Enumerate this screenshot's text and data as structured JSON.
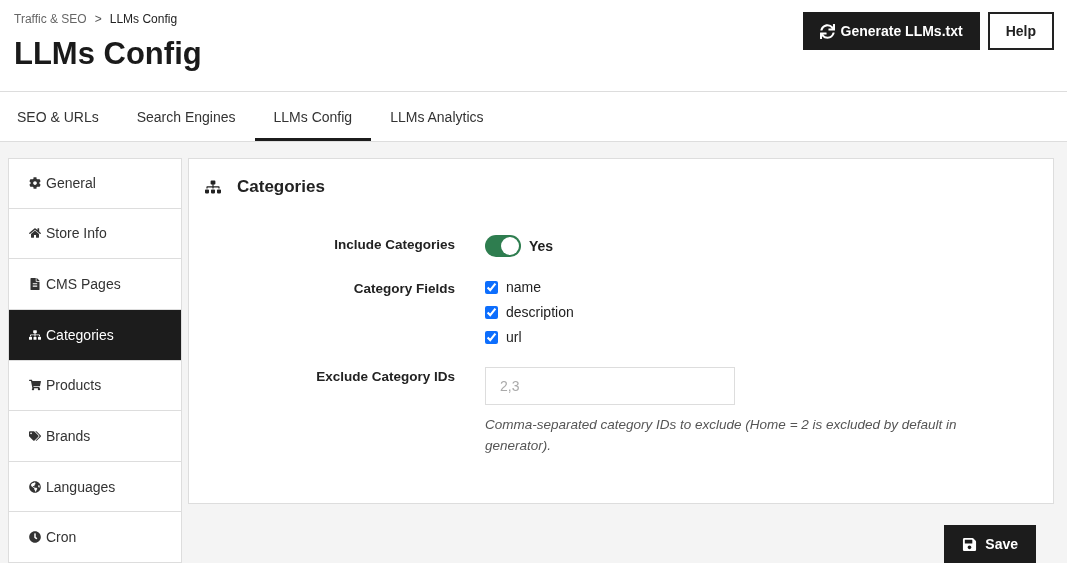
{
  "breadcrumb": [
    {
      "label": "Traffic & SEO",
      "current": false
    },
    {
      "label": "LLMs Config",
      "current": true
    }
  ],
  "breadcrumb_separator": ">",
  "title": "LLMs Config",
  "header_buttons": [
    {
      "label": "Generate LLMs.txt",
      "kind": "primary"
    },
    {
      "label": "Help",
      "kind": "outline"
    }
  ],
  "tabs": [
    {
      "label": "SEO & URLs",
      "selected": false
    },
    {
      "label": "Search Engines",
      "selected": false
    },
    {
      "label": "LLMs Config",
      "selected": true
    },
    {
      "label": "LLMs Analytics",
      "selected": false
    }
  ],
  "sidebar": {
    "items": [
      {
        "label": "General",
        "selected": false
      },
      {
        "label": "Store Info",
        "selected": false
      },
      {
        "label": "CMS Pages",
        "selected": false
      },
      {
        "label": "Categories",
        "selected": true
      },
      {
        "label": "Products",
        "selected": false
      },
      {
        "label": "Brands",
        "selected": false
      },
      {
        "label": "Languages",
        "selected": false
      },
      {
        "label": "Cron",
        "selected": false
      }
    ]
  },
  "panel": {
    "title": "Categories",
    "fields": [
      {
        "kind": "toggle",
        "label": "Include Categories",
        "on": true,
        "value_label": "Yes"
      },
      {
        "kind": "checkboxes",
        "label": "Category Fields",
        "options": [
          {
            "label": "name",
            "checked": true
          },
          {
            "label": "description",
            "checked": true
          },
          {
            "label": "url",
            "checked": true
          }
        ]
      },
      {
        "kind": "text",
        "label": "Exclude Category IDs",
        "placeholder": "2,3",
        "help": "Comma-separated category IDs to exclude (Home = 2 is excluded by default in generator)."
      }
    ]
  },
  "save_button": {
    "label": "Save"
  }
}
